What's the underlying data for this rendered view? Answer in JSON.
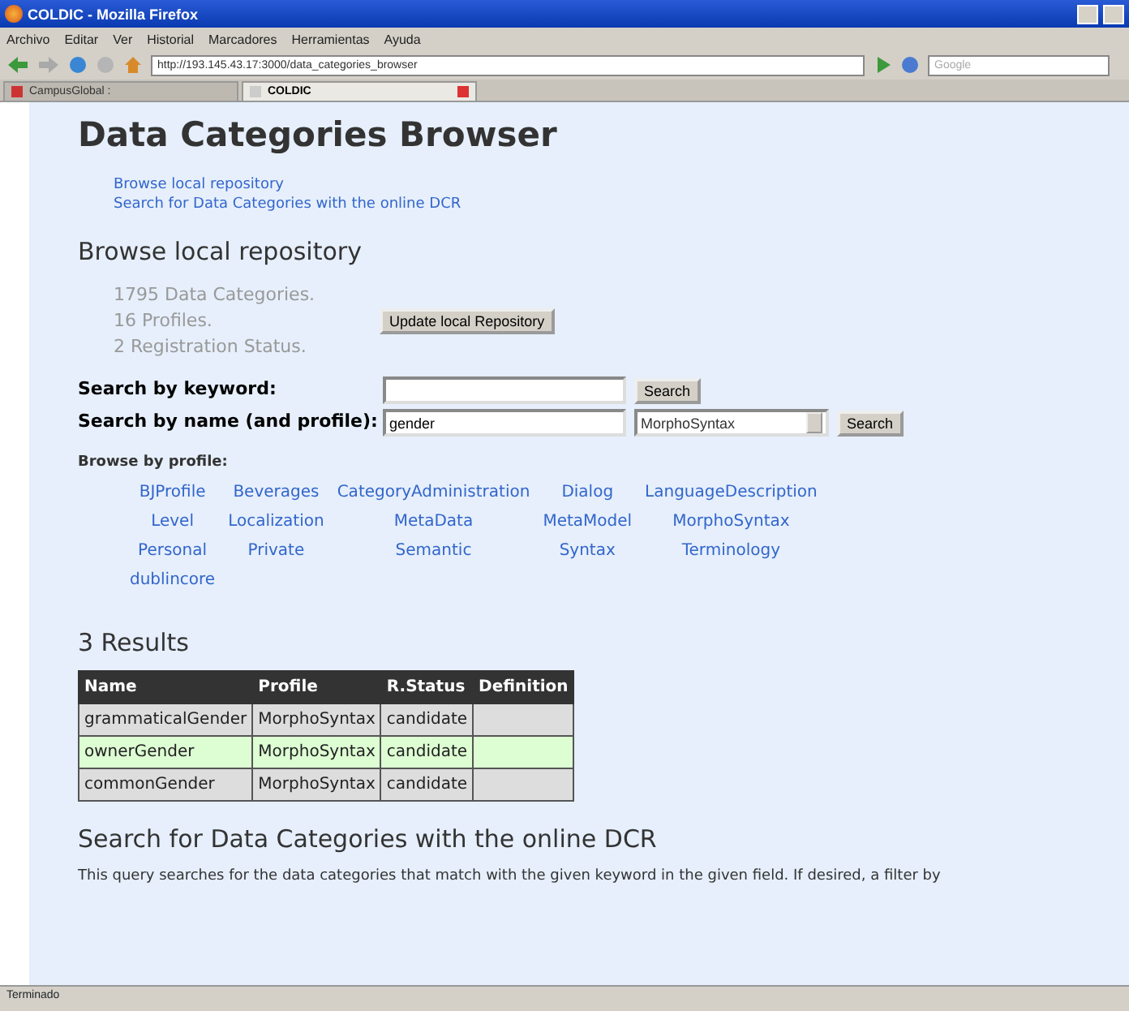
{
  "window": {
    "title": "COLDIC - Mozilla Firefox"
  },
  "menu": [
    "Archivo",
    "Editar",
    "Ver",
    "Historial",
    "Marcadores",
    "Herramientas",
    "Ayuda"
  ],
  "address": {
    "value": "http://193.145.43.17:3000/data_categories_browser"
  },
  "search_engine": {
    "placeholder": "Google"
  },
  "tabs": [
    {
      "label": "CampusGlobal :",
      "selected": false
    },
    {
      "label": "COLDIC",
      "selected": true
    }
  ],
  "page": {
    "title": "Data Categories Browser",
    "links": [
      "Browse local repository",
      "Search for Data Categories with the online DCR"
    ],
    "local_heading": "Browse local repository",
    "stats": [
      "1795 Data Categories.",
      "16 Profiles.",
      "2 Registration Status."
    ],
    "update_button": "Update local Repository",
    "keyword_search": {
      "label": "Search by keyword:",
      "button": "Search"
    },
    "name_search": {
      "label": "Search by name (and profile):",
      "value": "gender",
      "profile": "MorphoSyntax",
      "button": "Search"
    },
    "profiles_label": "Browse by profile:",
    "profiles": [
      [
        "BJProfile",
        "Beverages",
        "CategoryAdministration",
        "Dialog",
        "LanguageDescription"
      ],
      [
        "Level",
        "Localization",
        "MetaData",
        "MetaModel",
        "MorphoSyntax"
      ],
      [
        "Personal",
        "Private",
        "Semantic",
        "Syntax",
        "Terminology"
      ],
      [
        "dublincore"
      ]
    ],
    "results_heading": "3 Results",
    "table": {
      "columns": [
        "Name",
        "Profile",
        "R.Status",
        "Definition"
      ],
      "rows": [
        {
          "cells": [
            "grammaticalGender",
            "MorphoSyntax",
            "candidate",
            ""
          ],
          "highlighted": false
        },
        {
          "cells": [
            "ownerGender",
            "MorphoSyntax",
            "candidate",
            ""
          ],
          "highlighted": true
        },
        {
          "cells": [
            "commonGender",
            "MorphoSyntax",
            "candidate",
            ""
          ],
          "highlighted": false
        }
      ]
    },
    "dcr_heading": "Search for Data Categories with the online DCR",
    "dcr_text": "This query searches for the data categories that match with the given keyword in the given field. If desired, a filter by"
  },
  "status_bar": "Terminado"
}
